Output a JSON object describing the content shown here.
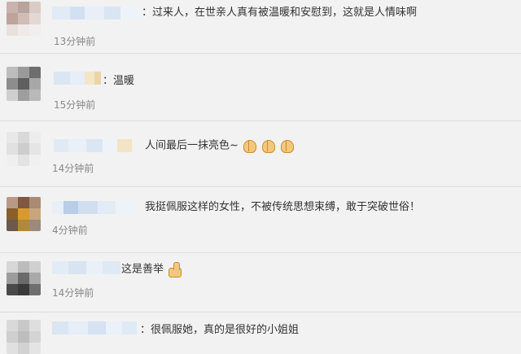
{
  "comments": [
    {
      "sep": "：",
      "text": "过来人，在世亲人真有被温暖和安慰到，这就是人情味啊",
      "emojis": [],
      "time": "13分钟前"
    },
    {
      "sep": "：",
      "text": "温暖",
      "emojis": [],
      "time": "15分钟前"
    },
    {
      "sep": "",
      "text": "人间最后一抹亮色~",
      "emojis": [
        "clap-emoji",
        "clap-emoji",
        "clap-emoji"
      ],
      "time": "14分钟前"
    },
    {
      "sep": "",
      "text": "我挺佩服这样的女性，不被传统思想束缚，敢于突破世俗！",
      "emojis": [],
      "time": "4分钟前"
    },
    {
      "sep": "",
      "text": "这是善举",
      "emojis": [
        "thumbs-up-emoji"
      ],
      "time": "14分钟前"
    },
    {
      "sep": "：",
      "text": "很佩服她，真的是很好的小姐姐",
      "emojis": [],
      "time": ""
    }
  ],
  "colors": {
    "background": "#f2f2f2",
    "text": "#333333",
    "time": "#888888",
    "divider": "#dedede"
  }
}
